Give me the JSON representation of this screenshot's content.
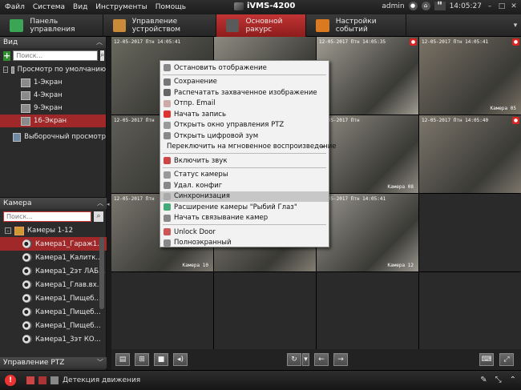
{
  "menu": [
    "Файл",
    "Система",
    "Вид",
    "Инструменты",
    "Помощь"
  ],
  "app_title": "iVMS-4200",
  "user": "admin",
  "time": "14:05:27",
  "tabs": [
    {
      "label": "Панель управления",
      "color": "#3aa655"
    },
    {
      "label": "Управление устройством",
      "color": "#c98b3a"
    },
    {
      "label": "Основной ракурс",
      "color": "#5a5a5a"
    },
    {
      "label": "Настройки событий",
      "color": "#d97a20"
    }
  ],
  "view_panel": {
    "title": "Вид",
    "search_placeholder": "Поиск...",
    "root": "Просмотр по умолчанию",
    "items": [
      "1-Экран",
      "4-Экран",
      "9-Экран",
      "16-Экран"
    ],
    "custom": "Выборочный просмотр"
  },
  "camera_panel": {
    "title": "Камера",
    "search_placeholder": "Поиск...",
    "group": "Камеры 1-12",
    "items": [
      "Камера1_Гараж1...",
      "Камера1_Калитк...",
      "Камера1_2эт ЛАБ...",
      "Камера1_Глав.вх...",
      "Камера1_Пищеб...",
      "Камера1_Пищеб...",
      "Камера1_Пищеб...",
      "Камера1_3эт КО..."
    ]
  },
  "ptz_panel": {
    "title": "Управление PTZ"
  },
  "cells": [
    {
      "stamp": "12-05-2017 Птн 14:05:41",
      "label": "",
      "rec": false,
      "bg": "#6b6a5f"
    },
    {
      "stamp": "",
      "label": "",
      "rec": false,
      "bg": "#8d8a80"
    },
    {
      "stamp": "12-05-2017 Птн 14:05:35",
      "label": "",
      "rec": true,
      "bg": "#a09c92"
    },
    {
      "stamp": "12-05-2017 Птн 14:05:41",
      "label": "Камера 05",
      "rec": true,
      "bg": "#7b7366"
    },
    {
      "stamp": "12-05-2017 Птн",
      "label": "",
      "rec": false,
      "bg": "#5f5e58"
    },
    {
      "stamp": "",
      "label": "",
      "rec": false,
      "bg": "#888479"
    },
    {
      "stamp": "12-05-2017 Птн",
      "label": "Камера 08",
      "rec": false,
      "bg": "#918d83"
    },
    {
      "stamp": "12-05-2017 Птн 14:05:40",
      "label": "",
      "rec": true,
      "bg": "#7d776c"
    },
    {
      "stamp": "12-05-2017 Птн",
      "label": "Камера 10",
      "rec": false,
      "bg": "#7a776e"
    },
    {
      "stamp": "12-05-2017 Птн 14:05:39",
      "label": "",
      "rec": false,
      "bg": "#837e73"
    },
    {
      "stamp": "12-05-2017 Птн 14:05:41",
      "label": "Камера 12",
      "rec": false,
      "bg": "#9a978f"
    },
    {
      "stamp": "",
      "label": "",
      "rec": false,
      "bg": ""
    },
    {
      "stamp": "",
      "label": "",
      "rec": false,
      "bg": ""
    },
    {
      "stamp": "",
      "label": "",
      "rec": false,
      "bg": ""
    },
    {
      "stamp": "",
      "label": "",
      "rec": false,
      "bg": ""
    },
    {
      "stamp": "",
      "label": "",
      "rec": false,
      "bg": ""
    }
  ],
  "context_menu": [
    {
      "label": "Остановить отображение",
      "icon": "#888",
      "sep_after": true
    },
    {
      "label": "Сохранение",
      "icon": "#777"
    },
    {
      "label": "Распечатать захваченное изображение",
      "icon": "#666"
    },
    {
      "label": "Отпр. Email",
      "icon": "#caa"
    },
    {
      "label": "Начать запись",
      "icon": "#d33"
    },
    {
      "label": "Открыть окно управления PTZ",
      "icon": "#999"
    },
    {
      "label": "Открыть цифровой зум",
      "icon": "#888"
    },
    {
      "label": "Переключить на мгновенное воспроизведение",
      "icon": "#777",
      "arrow": true,
      "sep_after": true
    },
    {
      "label": "Включить звук",
      "icon": "#c44",
      "sep_after": true
    },
    {
      "label": "Статус камеры",
      "icon": "#999"
    },
    {
      "label": "Удал. конфиг",
      "icon": "#888"
    },
    {
      "label": "Синхронизация",
      "icon": "#aaa",
      "highlight": true
    },
    {
      "label": "Расширение камеры \"Рыбий Глаз\"",
      "icon": "#4a7"
    },
    {
      "label": "Начать связывание камер",
      "icon": "#888",
      "sep_after": true
    },
    {
      "label": "Unlock Door",
      "icon": "#c55"
    },
    {
      "label": "Полноэкранный",
      "icon": "#888"
    }
  ],
  "status": {
    "motion": "Детекция движения"
  }
}
